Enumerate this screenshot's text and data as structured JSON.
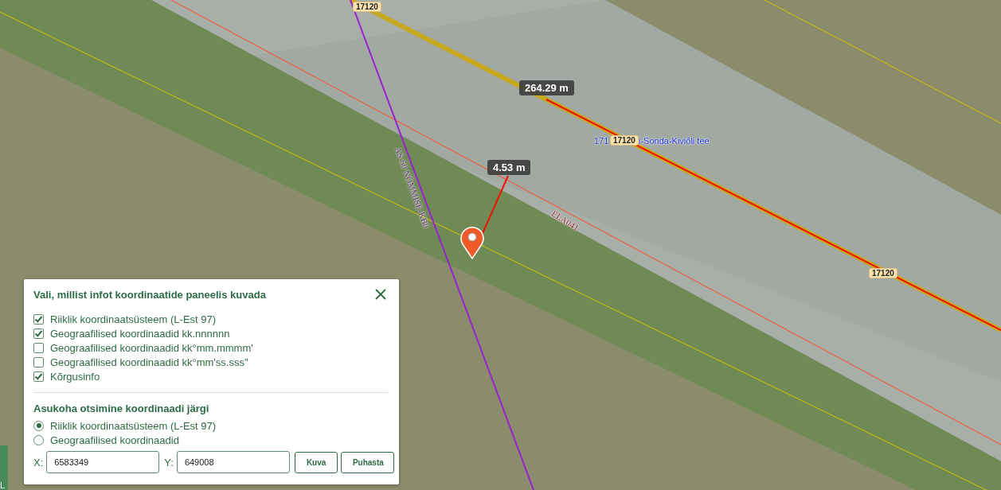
{
  "map": {
    "labels": [
      {
        "kind": "road_number",
        "text": "17120"
      },
      {
        "kind": "measurement",
        "text": "264.29 m"
      },
      {
        "kind": "road_name",
        "text": "171"
      },
      {
        "kind": "road_number",
        "text": "17120"
      },
      {
        "kind": "road_name",
        "text": "i-Sonda-Kiviõli tee"
      },
      {
        "kind": "measurement",
        "text": "4.53 m"
      },
      {
        "kind": "parcel_id",
        "text": "ELA041"
      },
      {
        "kind": "line_id",
        "text": "AS-50  NÕMMISE-KB0"
      },
      {
        "kind": "road_number",
        "text": "17120"
      }
    ],
    "side_tab": "L"
  },
  "panel": {
    "title": "Vali, millist infot koordinaatide paneelis kuvada",
    "options": [
      {
        "label": "Riiklik koordinaatsüsteem (L-Est 97)",
        "checked": true
      },
      {
        "label": "Geograafilised koordinaadid kk.nnnnnn",
        "checked": true
      },
      {
        "label": "Geograafilised koordinaadid kk°mm.mmmm'",
        "checked": false
      },
      {
        "label": "Geograafilised koordinaadid kk°mm'ss.sss\"",
        "checked": false
      },
      {
        "label": "Kõrgusinfo",
        "checked": true
      }
    ],
    "search_title": "Asukoha otsimine koordinaadi järgi",
    "systems": [
      {
        "label": "Riiklik koordinaatsüsteem (L-Est 97)",
        "selected": true
      },
      {
        "label": "Geograafilised koordinaadid",
        "selected": false
      }
    ],
    "fields": [
      {
        "label": "X:",
        "value": "6583349"
      },
      {
        "label": "Y:",
        "value": "649008"
      }
    ],
    "buttons": [
      "Kuva",
      "Puhasta"
    ]
  }
}
